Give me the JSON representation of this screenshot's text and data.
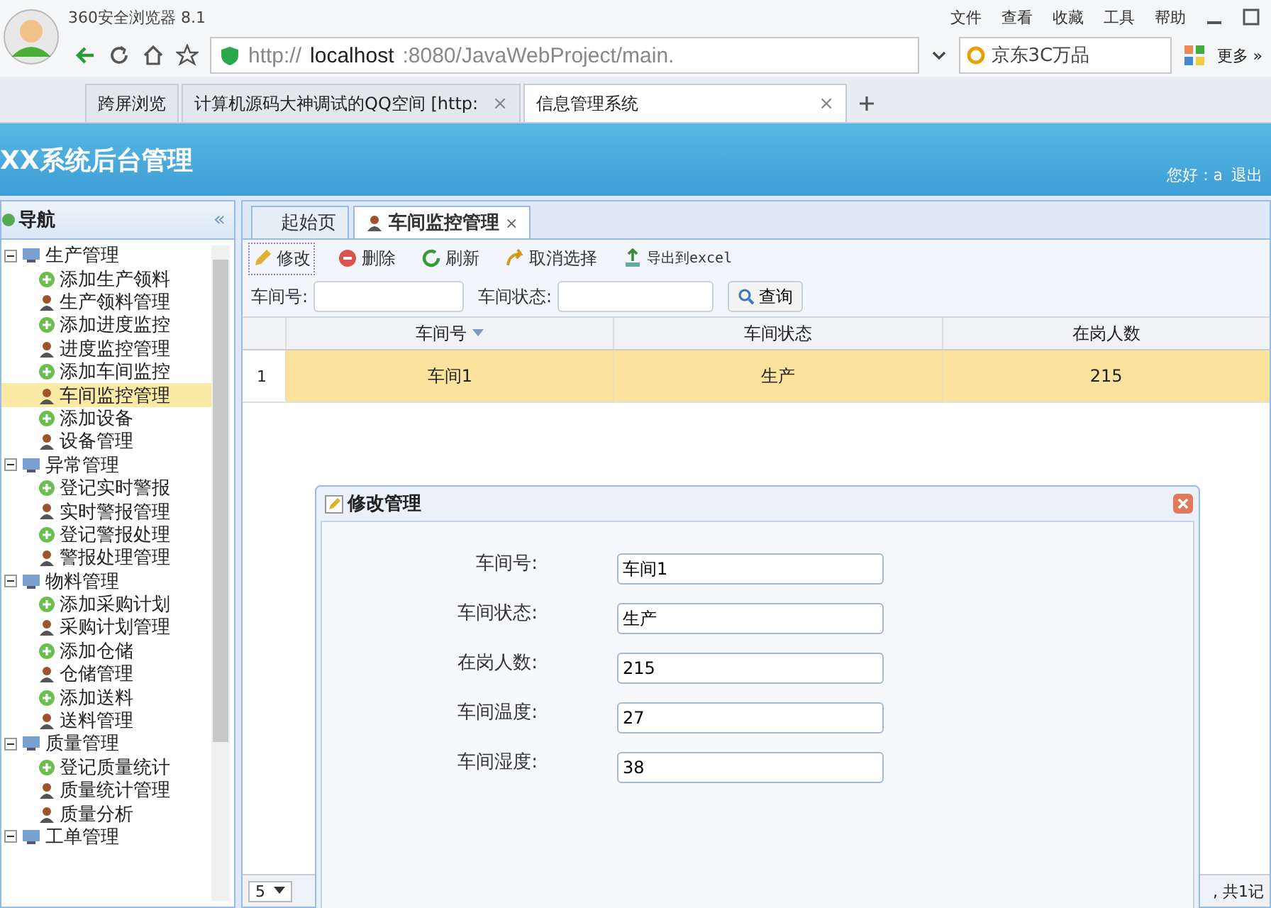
{
  "browser": {
    "title": "360安全浏览器 8.1",
    "menu": [
      "文件",
      "查看",
      "收藏",
      "工具",
      "帮助"
    ],
    "url": {
      "scheme": "http://",
      "host": "localhost",
      "path": ":8080/JavaWebProject/main."
    },
    "search": "京东3C万品",
    "more": "更多 »",
    "tabs": [
      {
        "label": "跨屏浏览",
        "selected": false
      },
      {
        "label": "计算机源码大神调试的QQ空间 [http:",
        "selected": false,
        "close": "×"
      },
      {
        "label": "信息管理系统",
        "selected": true,
        "close": "×"
      }
    ]
  },
  "header": {
    "title": "XX系统后台管理",
    "greeting": "您好：a",
    "logout": "退出"
  },
  "sidebar": {
    "title": "导航",
    "collapse": "«",
    "groups": [
      {
        "label": "生产管理",
        "expanded": true,
        "children": [
          {
            "label": "添加生产领料",
            "kind": "add",
            "selected": false
          },
          {
            "label": "生产领料管理",
            "kind": "manage",
            "selected": false
          },
          {
            "label": "添加进度监控",
            "kind": "add",
            "selected": false
          },
          {
            "label": "进度监控管理",
            "kind": "manage",
            "selected": false
          },
          {
            "label": "添加车间监控",
            "kind": "add",
            "selected": false
          },
          {
            "label": "车间监控管理",
            "kind": "manage",
            "selected": true
          },
          {
            "label": "添加设备",
            "kind": "add",
            "selected": false
          },
          {
            "label": "设备管理",
            "kind": "manage",
            "selected": false
          }
        ]
      },
      {
        "label": "异常管理",
        "expanded": true,
        "children": [
          {
            "label": "登记实时警报",
            "kind": "add",
            "selected": false
          },
          {
            "label": "实时警报管理",
            "kind": "manage",
            "selected": false
          },
          {
            "label": "登记警报处理",
            "kind": "add",
            "selected": false
          },
          {
            "label": "警报处理管理",
            "kind": "manage",
            "selected": false
          }
        ]
      },
      {
        "label": "物料管理",
        "expanded": true,
        "children": [
          {
            "label": "添加采购计划",
            "kind": "add",
            "selected": false
          },
          {
            "label": "采购计划管理",
            "kind": "manage",
            "selected": false
          },
          {
            "label": "添加仓储",
            "kind": "add",
            "selected": false
          },
          {
            "label": "仓储管理",
            "kind": "manage",
            "selected": false
          },
          {
            "label": "添加送料",
            "kind": "add",
            "selected": false
          },
          {
            "label": "送料管理",
            "kind": "manage",
            "selected": false
          }
        ]
      },
      {
        "label": "质量管理",
        "expanded": true,
        "children": [
          {
            "label": "登记质量统计",
            "kind": "add",
            "selected": false
          },
          {
            "label": "质量统计管理",
            "kind": "manage",
            "selected": false
          },
          {
            "label": "质量分析",
            "kind": "manage",
            "selected": false
          }
        ]
      },
      {
        "label": "工单管理",
        "expanded": true
      }
    ]
  },
  "content_tabs": [
    {
      "label": "起始页",
      "selected": false
    },
    {
      "label": "车间监控管理",
      "selected": true,
      "close": "×"
    }
  ],
  "toolbar": [
    {
      "label": "修改",
      "kind": "edit"
    },
    {
      "label": "删除",
      "kind": "delete"
    },
    {
      "label": "刷新",
      "kind": "refresh"
    },
    {
      "label": "取消选择",
      "kind": "undo"
    },
    {
      "label": "导出到excel",
      "kind": "export"
    }
  ],
  "filters": [
    {
      "label": "车间号:"
    },
    {
      "label": "车间状态:"
    }
  ],
  "search_button": "查询",
  "table": {
    "columns": [
      {
        "label": "车间号",
        "sorted": true
      },
      {
        "label": "车间状态",
        "sorted": false
      },
      {
        "label": "在岗人数",
        "sorted": false
      }
    ],
    "rows": [
      {
        "index": "1",
        "cells": [
          "车间1",
          "生产",
          "215"
        ],
        "selected": true
      }
    ]
  },
  "pager": {
    "page_size": "5",
    "summary": ", 共1记"
  },
  "dialog": {
    "title": "修改管理",
    "fields": [
      {
        "label": "车间号:",
        "value": "车间1"
      },
      {
        "label": "车间状态:",
        "value": "生产"
      },
      {
        "label": "在岗人数:",
        "value": "215"
      },
      {
        "label": "车间温度:",
        "value": "27"
      },
      {
        "label": "车间湿度:",
        "value": "38"
      }
    ]
  }
}
